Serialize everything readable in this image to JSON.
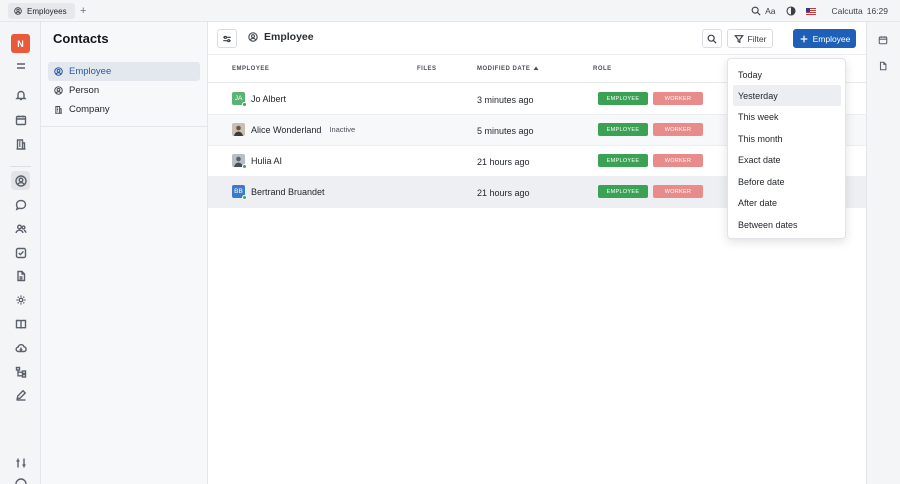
{
  "topbar": {
    "tab_label": "Employees",
    "font_label": "Aa",
    "location": "Calcutta",
    "time": "16:29"
  },
  "rail": {
    "logo_letter": "N"
  },
  "nav": {
    "title": "Contacts",
    "items": [
      {
        "label": "Employee",
        "icon": "person-circle-icon"
      },
      {
        "label": "Person",
        "icon": "person-circle-icon"
      },
      {
        "label": "Company",
        "icon": "building-icon"
      }
    ]
  },
  "header": {
    "title": "Employee",
    "filter_label": "Filter",
    "new_label": "Employee"
  },
  "table": {
    "columns": [
      "EMPLOYEE",
      "FILES",
      "MODIFIED DATE",
      "ROLE"
    ],
    "rows": [
      {
        "name": "Jo Albert",
        "initials": "JA",
        "avatar_color": "#5bb274",
        "status": "",
        "modified": "3 minutes ago",
        "roles": [
          "EMPLOYEE",
          "WORKER"
        ]
      },
      {
        "name": "Alice Wonderland",
        "initials": "",
        "avatar_color": "#8a6f5a",
        "status": "Inactive",
        "modified": "5 minutes ago",
        "roles": [
          "EMPLOYEE",
          "WORKER"
        ]
      },
      {
        "name": "Hulia AI",
        "initials": "",
        "avatar_color": "#7a8390",
        "status": "",
        "modified": "21 hours ago",
        "roles": [
          "EMPLOYEE",
          "WORKER"
        ]
      },
      {
        "name": "Bertrand Bruandet",
        "initials": "BB",
        "avatar_color": "#3d7bc9",
        "status": "",
        "modified": "21 hours ago",
        "roles": [
          "EMPLOYEE",
          "WORKER"
        ]
      }
    ]
  },
  "filter_menu": {
    "items": [
      "Today",
      "Yesterday",
      "This week",
      "This month",
      "Exact date",
      "Before date",
      "After date",
      "Between dates"
    ],
    "highlighted": "Yesterday"
  },
  "colors": {
    "accent": "#1e5fb8",
    "employee_badge": "#3ba155",
    "worker_badge": "#e88b8b",
    "logo": "#ea5a3a"
  }
}
